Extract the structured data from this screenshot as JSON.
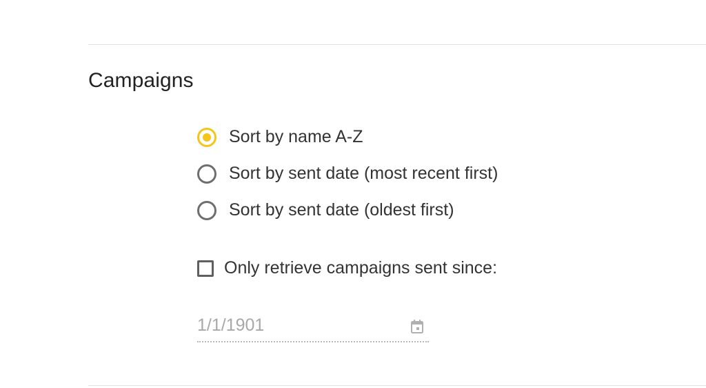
{
  "section": {
    "title": "Campaigns"
  },
  "sort_options": [
    {
      "label": "Sort by name A-Z",
      "selected": true
    },
    {
      "label": "Sort by sent date (most recent first)",
      "selected": false
    },
    {
      "label": "Sort by sent date (oldest first)",
      "selected": false
    }
  ],
  "filter": {
    "checkbox_label": "Only retrieve campaigns sent since:",
    "checked": false,
    "date_value": "1/1/1901"
  },
  "colors": {
    "accent": "#f5c518",
    "radio_unselected": "#6e6e6e",
    "text": "#333333",
    "disabled_text": "#a8a8a8"
  },
  "icons": {
    "date_field": "calendar-icon"
  }
}
